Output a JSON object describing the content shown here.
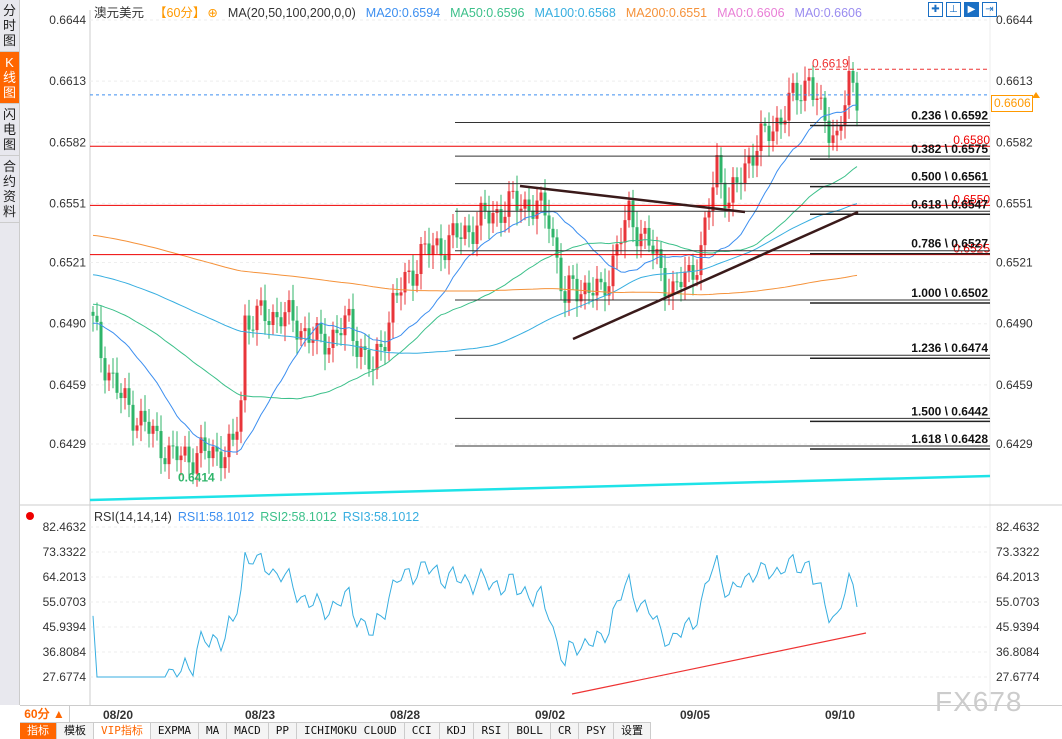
{
  "sidebar": [
    {
      "label": "分时图",
      "active": false
    },
    {
      "label": "K线图",
      "active": true
    },
    {
      "label": "闪电图",
      "active": false
    },
    {
      "label": "合约资料",
      "active": false
    }
  ],
  "legend": {
    "symbol": "澳元美元",
    "period": "【60分】",
    "indicator": "MA(20,50,100,200,0,0)",
    "items": [
      {
        "text": "MA20:0.6594",
        "color": "#3d8ff0"
      },
      {
        "text": "MA50:0.6596",
        "color": "#3cc08a"
      },
      {
        "text": "MA100:0.6568",
        "color": "#37aee0"
      },
      {
        "text": "MA200:0.6551",
        "color": "#f5923a"
      },
      {
        "text": "MA0:0.6606",
        "color": "#e97fd6"
      },
      {
        "text": "MA0:0.6606",
        "color": "#9a8cf0"
      }
    ]
  },
  "tools": [
    "crosshair-icon",
    "zoom-range-icon",
    "play-icon",
    "goto-end-icon"
  ],
  "current_price": "0.6606",
  "rsi_legend": {
    "title": "RSI(14,14,14)",
    "items": [
      {
        "text": "RSI1:58.1012",
        "color": "#3d8ff0"
      },
      {
        "text": "RSI2:58.1012",
        "color": "#3cc08a"
      },
      {
        "text": "RSI3:58.1012",
        "color": "#37aee0"
      }
    ]
  },
  "period_selector": "60分 ▲",
  "tabs": [
    {
      "label": "指标",
      "state": "active"
    },
    {
      "label": "模板",
      "state": ""
    },
    {
      "label": "VIP指标",
      "state": "vip"
    },
    {
      "label": "EXPMA"
    },
    {
      "label": "MA"
    },
    {
      "label": "MACD"
    },
    {
      "label": "PP"
    },
    {
      "label": "ICHIMOKU CLOUD"
    },
    {
      "label": "CCI"
    },
    {
      "label": "KDJ"
    },
    {
      "label": "RSI"
    },
    {
      "label": "BOLL"
    },
    {
      "label": "CR"
    },
    {
      "label": "PSY"
    },
    {
      "label": "设置"
    }
  ],
  "watermark": "FX678",
  "chart_data": {
    "type": "candlestick",
    "price_axis": {
      "ticks": [
        "0.6644",
        "0.6613",
        "0.6582",
        "0.6551",
        "0.6521",
        "0.6490",
        "0.6459",
        "0.6429"
      ],
      "range": [
        0.64,
        0.665
      ]
    },
    "x_ticks": [
      "08/20",
      "08/23",
      "08/28",
      "09/02",
      "09/05",
      "09/10"
    ],
    "close_waypoints": [
      [
        0,
        0.649
      ],
      [
        2,
        0.6475
      ],
      [
        7,
        0.6452
      ],
      [
        14,
        0.6436
      ],
      [
        20,
        0.6422
      ],
      [
        27,
        0.6424
      ],
      [
        35,
        0.6426
      ],
      [
        37,
        0.6452
      ],
      [
        38,
        0.6492
      ],
      [
        47,
        0.6495
      ],
      [
        57,
        0.648
      ],
      [
        64,
        0.649
      ],
      [
        70,
        0.6465
      ],
      [
        75,
        0.65
      ],
      [
        82,
        0.6525
      ],
      [
        92,
        0.6535
      ],
      [
        99,
        0.6545
      ],
      [
        107,
        0.6552
      ],
      [
        114,
        0.6545
      ],
      [
        118,
        0.65
      ],
      [
        120,
        0.651
      ],
      [
        127,
        0.6505
      ],
      [
        134,
        0.6545
      ],
      [
        139,
        0.653
      ],
      [
        145,
        0.6505
      ],
      [
        152,
        0.6525
      ],
      [
        156,
        0.6572
      ],
      [
        159,
        0.655
      ],
      [
        164,
        0.6575
      ],
      [
        172,
        0.6595
      ],
      [
        179,
        0.6615
      ],
      [
        182,
        0.6595
      ],
      [
        186,
        0.6585
      ],
      [
        189,
        0.661
      ],
      [
        191,
        0.6606
      ]
    ],
    "annotations": {
      "high": "0.6619",
      "low": "0.6414",
      "red_levels": [
        "0.6580",
        "0.6550",
        "0.6525"
      ]
    },
    "fibonacci": [
      {
        "label": "0.236 \\ 0.6592",
        "price": 0.6592
      },
      {
        "label": "0.382 \\ 0.6575",
        "price": 0.6575
      },
      {
        "label": "0.500 \\ 0.6561",
        "price": 0.6561
      },
      {
        "label": "0.618 \\ 0.6547",
        "price": 0.6547
      },
      {
        "label": "0.786 \\ 0.6527",
        "price": 0.6527
      },
      {
        "label": "1.000 \\ 0.6502",
        "price": 0.6502
      },
      {
        "label": "1.236 \\ 0.6474",
        "price": 0.6474
      },
      {
        "label": "1.500 \\ 0.6442",
        "price": 0.6442
      },
      {
        "label": "1.618 \\ 0.6428",
        "price": 0.6428
      }
    ],
    "rsi_axis": {
      "ticks": [
        "82.4632",
        "73.3322",
        "64.2013",
        "55.0703",
        "45.9394",
        "36.8084",
        "27.6774"
      ],
      "range": [
        27.6774,
        82.4632
      ]
    },
    "colors": {
      "up": "#e8353a",
      "down": "#2fb56a",
      "ma20": "#3d8ff0",
      "ma50": "#3cc08a",
      "ma100": "#37aee0",
      "ma200": "#f5923a",
      "rsi": "#37aee0"
    }
  }
}
